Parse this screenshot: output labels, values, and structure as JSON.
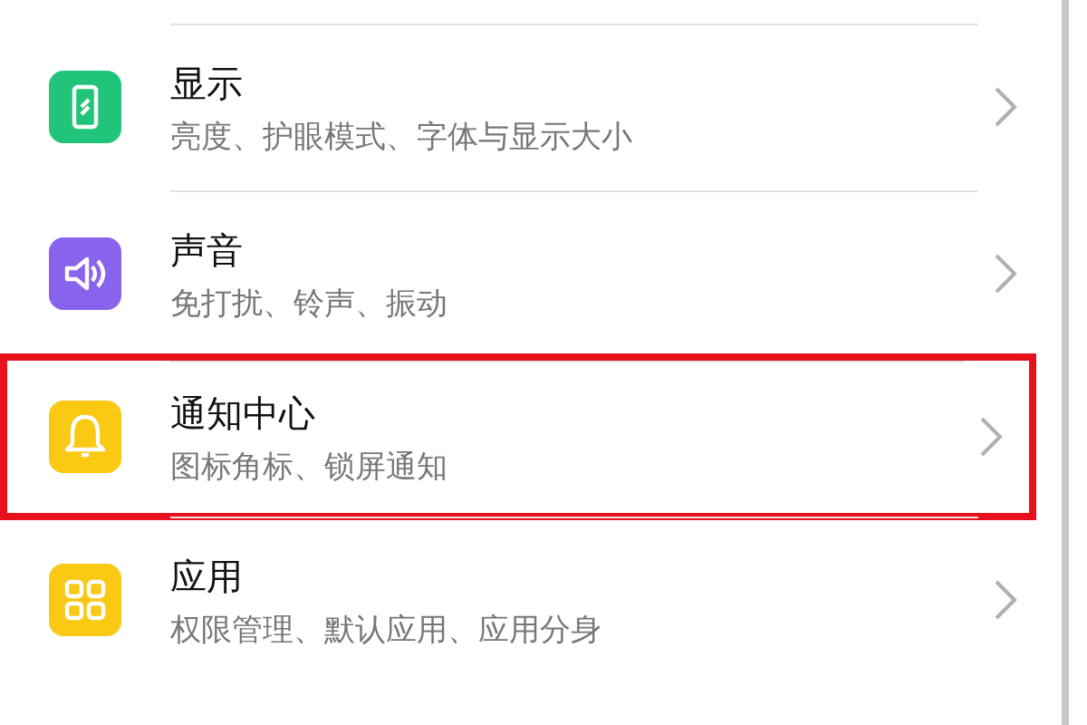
{
  "settings": [
    {
      "kind": "display",
      "title": "显示",
      "subtitle": "亮度、护眼模式、字体与显示大小",
      "color": "#22c47a",
      "highlighted": false
    },
    {
      "kind": "sound",
      "title": "声音",
      "subtitle": "免打扰、铃声、振动",
      "color": "#8a63ec",
      "highlighted": false
    },
    {
      "kind": "bell",
      "title": "通知中心",
      "subtitle": "图标角标、锁屏通知",
      "color": "#f9c914",
      "highlighted": true
    },
    {
      "kind": "apps",
      "title": "应用",
      "subtitle": "权限管理、默认应用、应用分身",
      "color": "#f9c914",
      "highlighted": false
    }
  ]
}
